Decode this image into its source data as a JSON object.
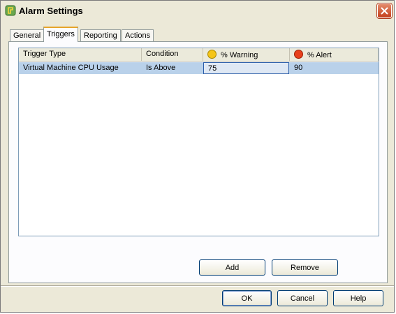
{
  "window": {
    "title": "Alarm Settings",
    "icon": "alarm-settings-icon"
  },
  "tabs": [
    {
      "label": "General",
      "active": false
    },
    {
      "label": "Triggers",
      "active": true
    },
    {
      "label": "Reporting",
      "active": false
    },
    {
      "label": "Actions",
      "active": false
    }
  ],
  "table": {
    "columns": [
      {
        "label": "Trigger Type",
        "icon": null
      },
      {
        "label": "Condition",
        "icon": null
      },
      {
        "label": "% Warning",
        "icon": "warning-icon",
        "icon_color": "#f5c518"
      },
      {
        "label": "% Alert",
        "icon": "alert-icon",
        "icon_color": "#e8401c"
      }
    ],
    "rows": [
      {
        "trigger_type": "Virtual Machine CPU Usage",
        "condition": "Is Above",
        "warning": "75",
        "alert": "90"
      }
    ]
  },
  "panel_buttons": {
    "add": "Add",
    "remove": "Remove"
  },
  "dialog_buttons": {
    "ok": "OK",
    "cancel": "Cancel",
    "help": "Help"
  },
  "colors": {
    "selection": "#b9d1ea",
    "tab_highlight": "#e6a42b",
    "close_button": "#c4411e"
  }
}
